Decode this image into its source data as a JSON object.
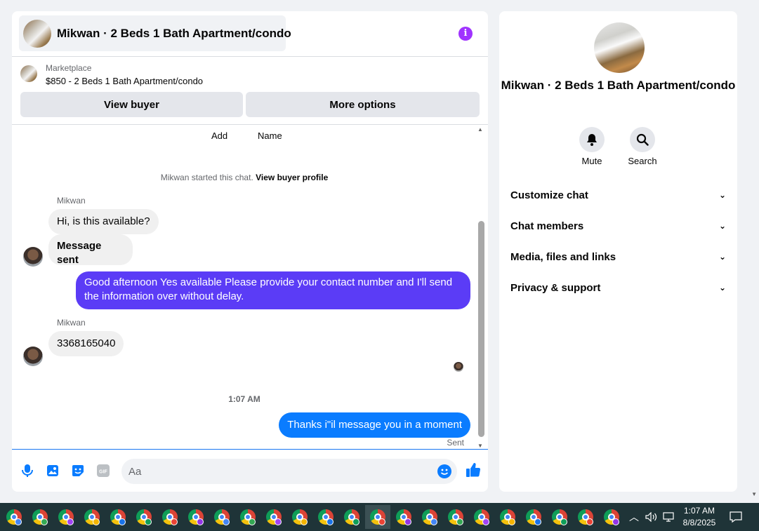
{
  "chat": {
    "title": "Mikwan · 2 Beds 1 Bath Apartment/condo",
    "marketplace_label": "Marketplace",
    "listing": "$850 - 2 Beds 1 Bath Apartment/condo",
    "view_buyer_label": "View buyer",
    "more_options_label": "More options",
    "top_actions": [
      "Add",
      "Name"
    ],
    "started_text": "Mikwan started this chat.",
    "view_profile_label": "View buyer profile",
    "messages": [
      {
        "sender": "Mikwan",
        "text": "Hi, is this available?"
      },
      {
        "text": "Message sent"
      },
      {
        "text": "Good afternoon Yes available Please provide your contact number and I'll send the information over without delay."
      },
      {
        "sender": "Mikwan",
        "text": "3368165040"
      },
      {
        "text": "Thanks i\"il message you in a moment"
      }
    ],
    "time_separator": "1:07 AM",
    "sent_status": "Sent",
    "composer_placeholder": "Aa",
    "composer_icons": [
      "microphone-icon",
      "image-icon",
      "sticker-icon",
      "gif-icon",
      "emoji-icon",
      "thumbs-up-icon"
    ]
  },
  "info": {
    "title": "Mikwan · 2 Beds 1 Bath Apartment/condo",
    "mute_label": "Mute",
    "search_label": "Search",
    "sections": [
      "Customize chat",
      "Chat members",
      "Media, files and links",
      "Privacy & support"
    ]
  },
  "taskbar": {
    "time": "1:07 AM",
    "date": "8/8/2025",
    "app_count": 24,
    "active_index": 14
  },
  "colors": {
    "accent": "#0a7cff",
    "outgoing_purple": "#5b3cf6",
    "info_icon": "#a033ff"
  }
}
